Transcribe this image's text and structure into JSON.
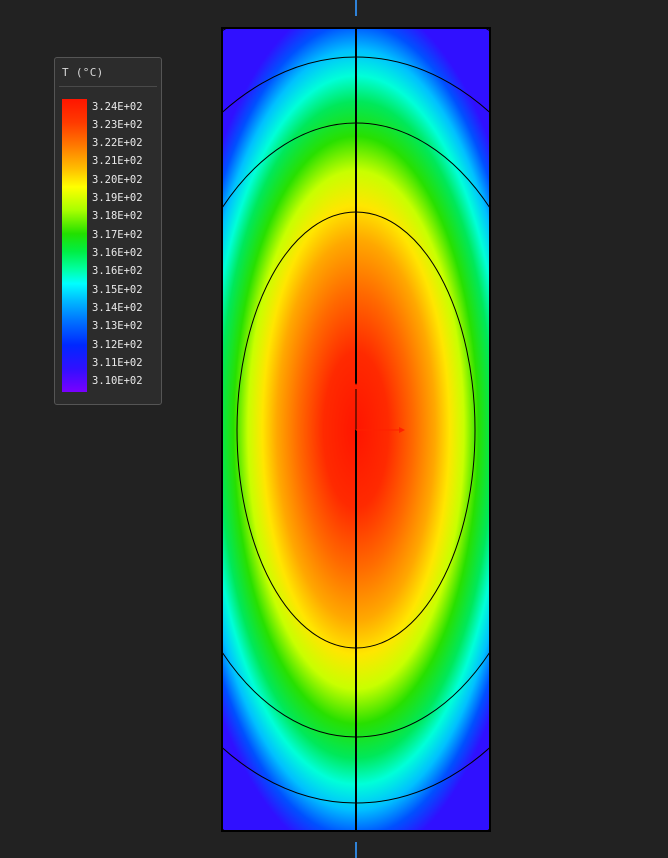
{
  "legend": {
    "title": "T (°C)",
    "labels": [
      "3.24E+02",
      "3.23E+02",
      "3.22E+02",
      "3.21E+02",
      "3.20E+02",
      "3.19E+02",
      "3.18E+02",
      "3.17E+02",
      "3.16E+02",
      "3.16E+02",
      "3.15E+02",
      "3.14E+02",
      "3.13E+02",
      "3.12E+02",
      "3.11E+02",
      "3.10E+02"
    ]
  },
  "colors": {
    "background": "#222222",
    "colormap": [
      "#ff1500",
      "#ff7a00",
      "#ffff00",
      "#22e000",
      "#00ffff",
      "#0070ff",
      "#0028ff",
      "#7a00ff"
    ],
    "axis_marker": "#2f82d8",
    "flow_arrow": "#ff2000"
  }
}
